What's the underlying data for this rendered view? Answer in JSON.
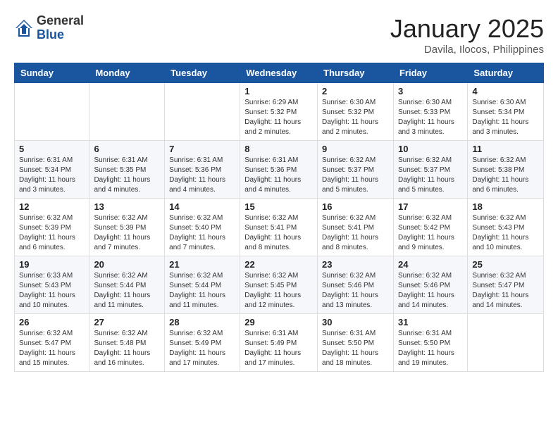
{
  "logo": {
    "general": "General",
    "blue": "Blue"
  },
  "title": "January 2025",
  "location": "Davila, Ilocos, Philippines",
  "days_of_week": [
    "Sunday",
    "Monday",
    "Tuesday",
    "Wednesday",
    "Thursday",
    "Friday",
    "Saturday"
  ],
  "weeks": [
    [
      {
        "day": "",
        "info": ""
      },
      {
        "day": "",
        "info": ""
      },
      {
        "day": "",
        "info": ""
      },
      {
        "day": "1",
        "info": "Sunrise: 6:29 AM\nSunset: 5:32 PM\nDaylight: 11 hours\nand 2 minutes."
      },
      {
        "day": "2",
        "info": "Sunrise: 6:30 AM\nSunset: 5:32 PM\nDaylight: 11 hours\nand 2 minutes."
      },
      {
        "day": "3",
        "info": "Sunrise: 6:30 AM\nSunset: 5:33 PM\nDaylight: 11 hours\nand 3 minutes."
      },
      {
        "day": "4",
        "info": "Sunrise: 6:30 AM\nSunset: 5:34 PM\nDaylight: 11 hours\nand 3 minutes."
      }
    ],
    [
      {
        "day": "5",
        "info": "Sunrise: 6:31 AM\nSunset: 5:34 PM\nDaylight: 11 hours\nand 3 minutes."
      },
      {
        "day": "6",
        "info": "Sunrise: 6:31 AM\nSunset: 5:35 PM\nDaylight: 11 hours\nand 4 minutes."
      },
      {
        "day": "7",
        "info": "Sunrise: 6:31 AM\nSunset: 5:36 PM\nDaylight: 11 hours\nand 4 minutes."
      },
      {
        "day": "8",
        "info": "Sunrise: 6:31 AM\nSunset: 5:36 PM\nDaylight: 11 hours\nand 4 minutes."
      },
      {
        "day": "9",
        "info": "Sunrise: 6:32 AM\nSunset: 5:37 PM\nDaylight: 11 hours\nand 5 minutes."
      },
      {
        "day": "10",
        "info": "Sunrise: 6:32 AM\nSunset: 5:37 PM\nDaylight: 11 hours\nand 5 minutes."
      },
      {
        "day": "11",
        "info": "Sunrise: 6:32 AM\nSunset: 5:38 PM\nDaylight: 11 hours\nand 6 minutes."
      }
    ],
    [
      {
        "day": "12",
        "info": "Sunrise: 6:32 AM\nSunset: 5:39 PM\nDaylight: 11 hours\nand 6 minutes."
      },
      {
        "day": "13",
        "info": "Sunrise: 6:32 AM\nSunset: 5:39 PM\nDaylight: 11 hours\nand 7 minutes."
      },
      {
        "day": "14",
        "info": "Sunrise: 6:32 AM\nSunset: 5:40 PM\nDaylight: 11 hours\nand 7 minutes."
      },
      {
        "day": "15",
        "info": "Sunrise: 6:32 AM\nSunset: 5:41 PM\nDaylight: 11 hours\nand 8 minutes."
      },
      {
        "day": "16",
        "info": "Sunrise: 6:32 AM\nSunset: 5:41 PM\nDaylight: 11 hours\nand 8 minutes."
      },
      {
        "day": "17",
        "info": "Sunrise: 6:32 AM\nSunset: 5:42 PM\nDaylight: 11 hours\nand 9 minutes."
      },
      {
        "day": "18",
        "info": "Sunrise: 6:32 AM\nSunset: 5:43 PM\nDaylight: 11 hours\nand 10 minutes."
      }
    ],
    [
      {
        "day": "19",
        "info": "Sunrise: 6:33 AM\nSunset: 5:43 PM\nDaylight: 11 hours\nand 10 minutes."
      },
      {
        "day": "20",
        "info": "Sunrise: 6:32 AM\nSunset: 5:44 PM\nDaylight: 11 hours\nand 11 minutes."
      },
      {
        "day": "21",
        "info": "Sunrise: 6:32 AM\nSunset: 5:44 PM\nDaylight: 11 hours\nand 11 minutes."
      },
      {
        "day": "22",
        "info": "Sunrise: 6:32 AM\nSunset: 5:45 PM\nDaylight: 11 hours\nand 12 minutes."
      },
      {
        "day": "23",
        "info": "Sunrise: 6:32 AM\nSunset: 5:46 PM\nDaylight: 11 hours\nand 13 minutes."
      },
      {
        "day": "24",
        "info": "Sunrise: 6:32 AM\nSunset: 5:46 PM\nDaylight: 11 hours\nand 14 minutes."
      },
      {
        "day": "25",
        "info": "Sunrise: 6:32 AM\nSunset: 5:47 PM\nDaylight: 11 hours\nand 14 minutes."
      }
    ],
    [
      {
        "day": "26",
        "info": "Sunrise: 6:32 AM\nSunset: 5:47 PM\nDaylight: 11 hours\nand 15 minutes."
      },
      {
        "day": "27",
        "info": "Sunrise: 6:32 AM\nSunset: 5:48 PM\nDaylight: 11 hours\nand 16 minutes."
      },
      {
        "day": "28",
        "info": "Sunrise: 6:32 AM\nSunset: 5:49 PM\nDaylight: 11 hours\nand 17 minutes."
      },
      {
        "day": "29",
        "info": "Sunrise: 6:31 AM\nSunset: 5:49 PM\nDaylight: 11 hours\nand 17 minutes."
      },
      {
        "day": "30",
        "info": "Sunrise: 6:31 AM\nSunset: 5:50 PM\nDaylight: 11 hours\nand 18 minutes."
      },
      {
        "day": "31",
        "info": "Sunrise: 6:31 AM\nSunset: 5:50 PM\nDaylight: 11 hours\nand 19 minutes."
      },
      {
        "day": "",
        "info": ""
      }
    ]
  ]
}
